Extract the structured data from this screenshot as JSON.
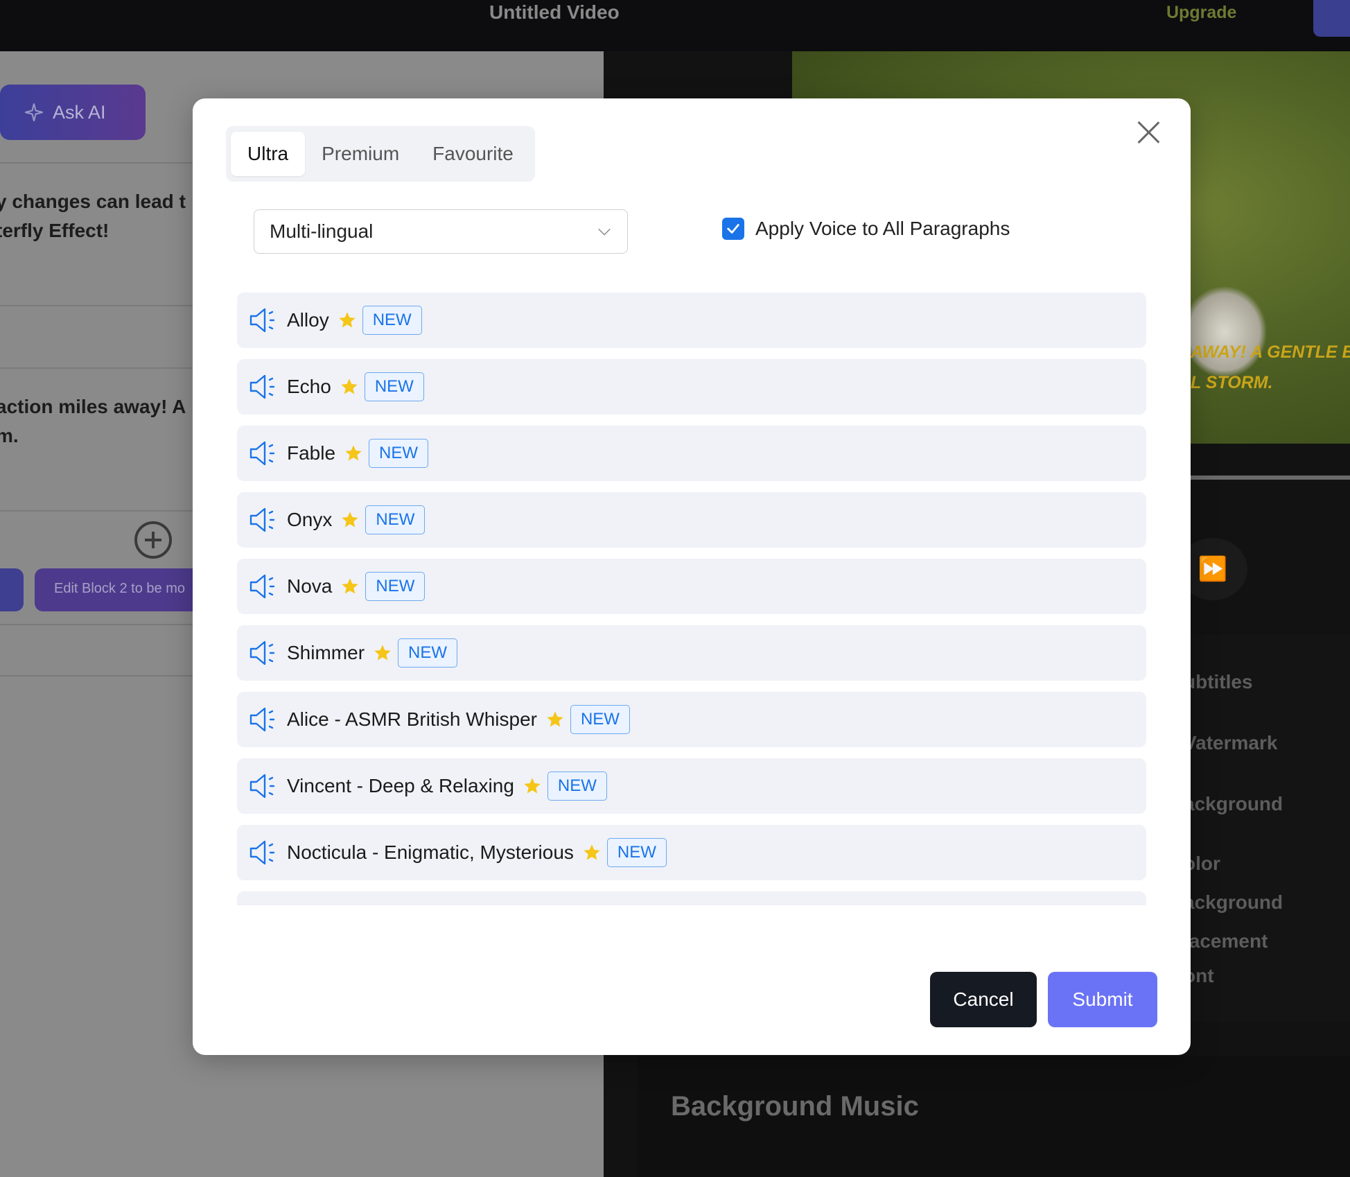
{
  "topbar": {
    "title": "Untitled Video",
    "upgrade_label": "Upgrade"
  },
  "left_panel": {
    "ask_ai_label": "Ask AI",
    "block1_text": "y changes can lead t\nterfly Effect!",
    "block2_text": "action miles away! A \nm.",
    "edit_block_label": "Edit Block 2 to be mo"
  },
  "right_panel": {
    "caption_line1": "AWAY! A GENTLE BREEZ",
    "caption_line2": "L STORM.",
    "settings_items": [
      "ubtitles",
      "Vatermark",
      "ackground",
      "olor",
      "ackground",
      "lacement",
      "ont"
    ],
    "background_music": "Background Music"
  },
  "modal": {
    "tabs": [
      "Ultra",
      "Premium",
      "Favourite"
    ],
    "active_tab": "Ultra",
    "language_select": "Multi-lingual",
    "apply_all_label": "Apply Voice to All Paragraphs",
    "apply_all_checked": true,
    "badge_label": "NEW",
    "voices": [
      "Alloy",
      "Echo",
      "Fable",
      "Onyx",
      "Nova",
      "Shimmer",
      "Alice - ASMR British Whisper",
      "Vincent - Deep & Relaxing",
      "Nocticula - Enigmatic, Mysterious"
    ],
    "cancel_label": "Cancel",
    "submit_label": "Submit"
  },
  "colors": {
    "accent_blue": "#1a73e8",
    "submit_bg": "#6a73f5",
    "cancel_bg": "#161a22",
    "star": "#f5c518",
    "row_bg": "#f0f2f7"
  },
  "icons": {
    "voice_icon": "speaker-icon",
    "favourite_icon": "star-icon",
    "close_icon": "close-icon",
    "dropdown_icon": "chevron-down-icon",
    "ask_ai_icon": "sparkle-icon"
  }
}
